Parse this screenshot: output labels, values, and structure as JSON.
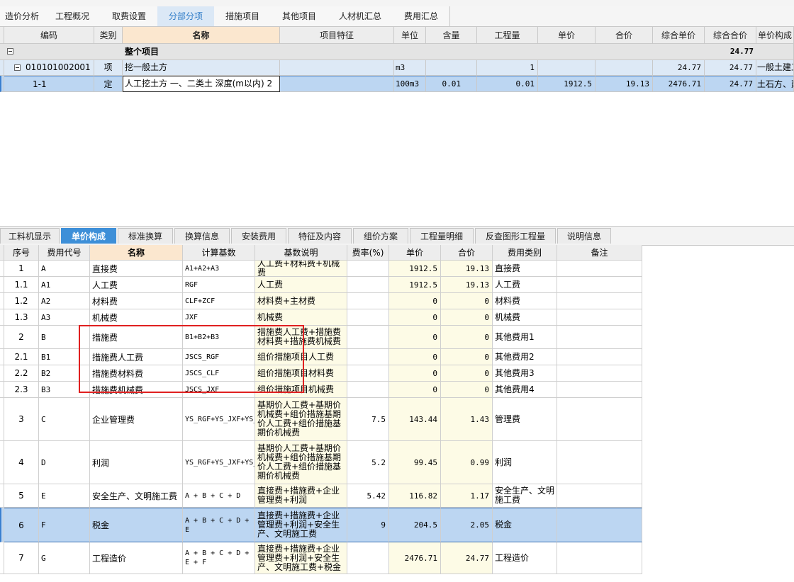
{
  "window": {
    "title_fragment": "",
    "right_fragment": ""
  },
  "main_tabs": [
    {
      "label": "造价分析"
    },
    {
      "label": "工程概况"
    },
    {
      "label": "取费设置"
    },
    {
      "label": "分部分项"
    },
    {
      "label": "措施项目"
    },
    {
      "label": "其他项目"
    },
    {
      "label": "人材机汇总"
    },
    {
      "label": "费用汇总"
    }
  ],
  "upper_table": {
    "headers": [
      "编码",
      "类别",
      "名称",
      "项目特征",
      "单位",
      "含量",
      "工程量",
      "单价",
      "合价",
      "综合单价",
      "综合合价",
      "单价构成"
    ],
    "rows": [
      {
        "code": "",
        "type": "",
        "name": "整个项目",
        "feature": "",
        "unit": "",
        "content": "",
        "qty": "",
        "price": "",
        "total": "",
        "comp_price": "",
        "comp_total": "24.77",
        "price_comp": ""
      },
      {
        "code": "010101002001",
        "type": "项",
        "name": "挖一般土方",
        "feature": "",
        "unit": "m3",
        "content": "",
        "qty": "1",
        "price": "",
        "total": "",
        "comp_price": "24.77",
        "comp_total": "24.77",
        "price_comp": "一般土建工"
      },
      {
        "code": "1-1",
        "type": "定",
        "name": "人工挖土方 一、二类土 深度(m以内) 2",
        "feature": "",
        "unit": "100m3",
        "content": "0.01",
        "qty": "0.01",
        "price": "1912.5",
        "total": "19.13",
        "comp_price": "2476.71",
        "comp_total": "24.77",
        "price_comp": "土石方、建"
      }
    ]
  },
  "lower_tabs": [
    {
      "label": "工料机显示"
    },
    {
      "label": "单价构成"
    },
    {
      "label": "标准换算"
    },
    {
      "label": "换算信息"
    },
    {
      "label": "安装费用"
    },
    {
      "label": "特征及内容"
    },
    {
      "label": "组价方案"
    },
    {
      "label": "工程量明细"
    },
    {
      "label": "反查图形工程量"
    },
    {
      "label": "说明信息"
    }
  ],
  "lower_table": {
    "headers": [
      "序号",
      "费用代号",
      "名称",
      "计算基数",
      "基数说明",
      "费率(%)",
      "单价",
      "合价",
      "费用类别",
      "备注"
    ],
    "rows": [
      {
        "seq": "1",
        "code": "A",
        "name": "直接费",
        "base": "A1+A2+A3",
        "desc": "人工费+材料费+机械费",
        "rate": "",
        "price": "1912.5",
        "total": "19.13",
        "cat": "直接费",
        "note": ""
      },
      {
        "seq": "1.1",
        "code": "A1",
        "name": "人工费",
        "base": "RGF",
        "desc": "人工费",
        "rate": "",
        "price": "1912.5",
        "total": "19.13",
        "cat": "人工费",
        "note": ""
      },
      {
        "seq": "1.2",
        "code": "A2",
        "name": "材料费",
        "base": "CLF+ZCF",
        "desc": "材料费+主材费",
        "rate": "",
        "price": "0",
        "total": "0",
        "cat": "材料费",
        "note": ""
      },
      {
        "seq": "1.3",
        "code": "A3",
        "name": "机械费",
        "base": "JXF",
        "desc": "机械费",
        "rate": "",
        "price": "0",
        "total": "0",
        "cat": "机械费",
        "note": ""
      },
      {
        "seq": "2",
        "code": "B",
        "name": "措施费",
        "base": "B1+B2+B3",
        "desc": "措施费人工费+措施费材料费+措施费机械费",
        "rate": "",
        "price": "0",
        "total": "0",
        "cat": "其他费用1",
        "note": ""
      },
      {
        "seq": "2.1",
        "code": "B1",
        "name": "措施费人工费",
        "base": "JSCS_RGF",
        "desc": "组价措施项目人工费",
        "rate": "",
        "price": "0",
        "total": "0",
        "cat": "其他费用2",
        "note": ""
      },
      {
        "seq": "2.2",
        "code": "B2",
        "name": "措施费材料费",
        "base": "JSCS_CLF",
        "desc": "组价措施项目材料费",
        "rate": "",
        "price": "0",
        "total": "0",
        "cat": "其他费用3",
        "note": ""
      },
      {
        "seq": "2.3",
        "code": "B3",
        "name": "措施费机械费",
        "base": "JSCS_JXF",
        "desc": "组价措施项目机械费",
        "rate": "",
        "price": "0",
        "total": "0",
        "cat": "其他费用4",
        "note": ""
      },
      {
        "seq": "3",
        "code": "C",
        "name": "企业管理费",
        "base": "YS_RGF+YS_JXF+YS_JSCS_RGF+YS_JSCS_JXF",
        "desc": "基期价人工费+基期价机械费+组价措施基期价人工费+组价措施基期价机械费",
        "rate": "7.5",
        "price": "143.44",
        "total": "1.43",
        "cat": "管理费",
        "note": ""
      },
      {
        "seq": "4",
        "code": "D",
        "name": "利润",
        "base": "YS_RGF+YS_JXF+YS_JSCS_RGF+YS_JSCS_JXF",
        "desc": "基期价人工费+基期价机械费+组价措施基期价人工费+组价措施基期价机械费",
        "rate": "5.2",
        "price": "99.45",
        "total": "0.99",
        "cat": "利润",
        "note": ""
      },
      {
        "seq": "5",
        "code": "E",
        "name": "安全生产、文明施工费",
        "base": "A + B + C + D",
        "desc": "直接费+措施费+企业管理费+利润",
        "rate": "5.42",
        "price": "116.82",
        "total": "1.17",
        "cat": "安全生产、文明施工费",
        "note": ""
      },
      {
        "seq": "6",
        "code": "F",
        "name": "税金",
        "base": "A + B + C + D + E",
        "desc": "直接费+措施费+企业管理费+利润+安全生产、文明施工费",
        "rate": "9",
        "price": "204.5",
        "total": "2.05",
        "cat": "税金",
        "note": ""
      },
      {
        "seq": "7",
        "code": "G",
        "name": "工程造价",
        "base": "A + B + C + D + E + F",
        "desc": "直接费+措施费+企业管理费+利润+安全生产、文明施工费+税金",
        "rate": "",
        "price": "2476.71",
        "total": "24.77",
        "cat": "工程造价",
        "note": ""
      }
    ]
  },
  "colors": {
    "active_tab": "#3d8fd8",
    "selected_row": "#bcd6f2",
    "highlight_box": "#e02020",
    "name_header": "#fbe7cf"
  }
}
